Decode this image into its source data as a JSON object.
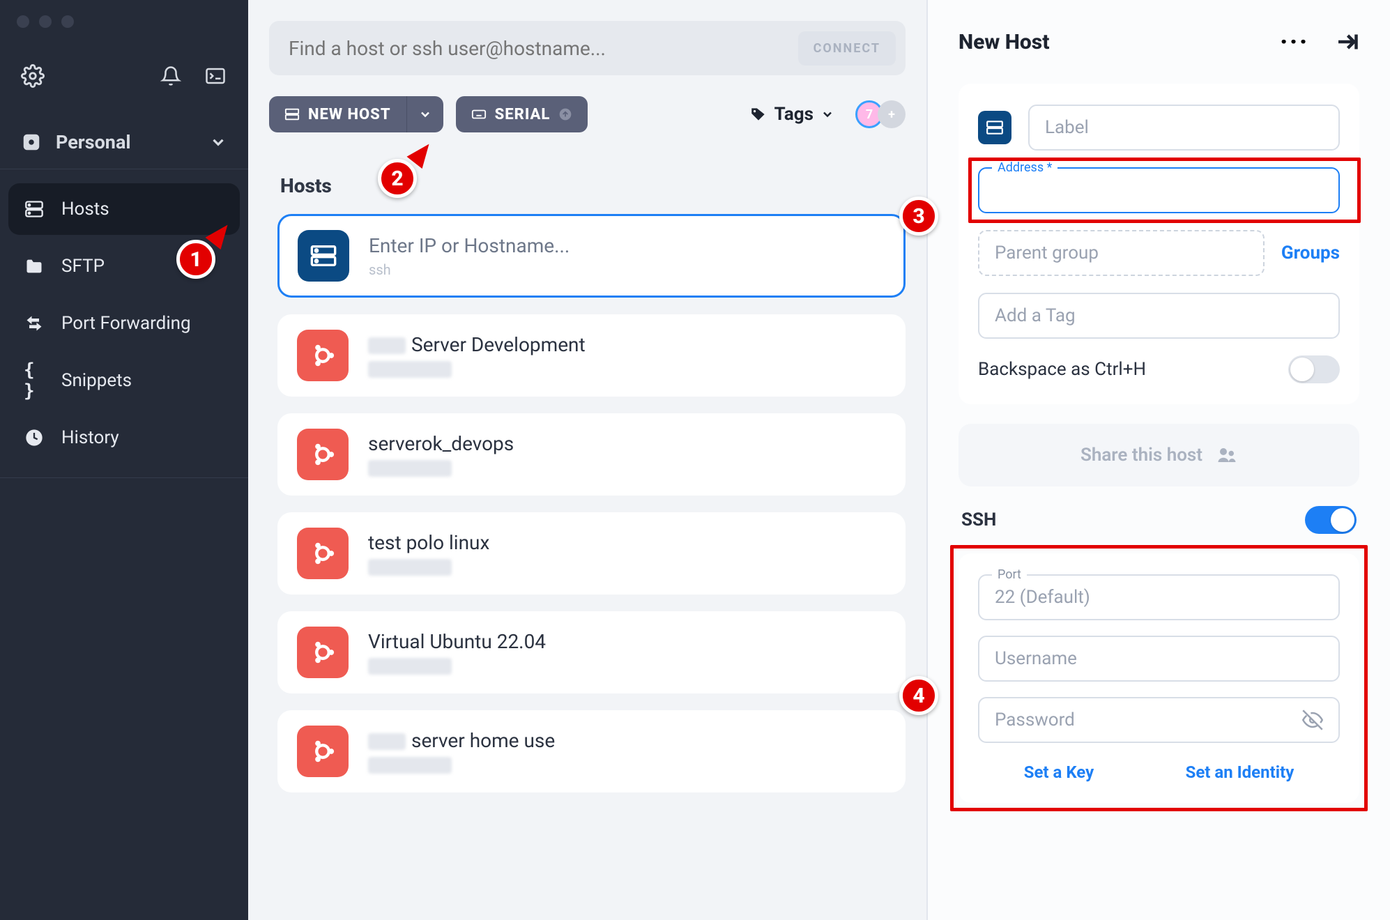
{
  "sidebar": {
    "vault_label": "Personal",
    "items": [
      {
        "label": "Hosts",
        "icon": "server",
        "active": true
      },
      {
        "label": "SFTP",
        "icon": "folder",
        "active": false
      },
      {
        "label": "Port Forwarding",
        "icon": "arrows",
        "active": false
      },
      {
        "label": "Snippets",
        "icon": "braces",
        "active": false
      },
      {
        "label": "History",
        "icon": "clock",
        "active": false
      }
    ]
  },
  "search": {
    "placeholder": "Find a host or ssh user@hostname...",
    "connect_label": "CONNECT"
  },
  "toolbar": {
    "new_host_label": "NEW HOST",
    "serial_label": "SERIAL",
    "tags_label": "Tags",
    "avatar_badge": "7"
  },
  "hosts": {
    "section_title": "Hosts",
    "new_entry": {
      "title": "Enter IP or Hostname...",
      "sub": "ssh"
    },
    "list": [
      {
        "title": "Server Development",
        "has_blur_prefix": true
      },
      {
        "title": "serverok_devops",
        "has_blur_prefix": false
      },
      {
        "title": "test polo linux",
        "has_blur_prefix": false
      },
      {
        "title": "Virtual Ubuntu 22.04",
        "has_blur_prefix": false
      },
      {
        "title": "server home use",
        "has_blur_prefix": true
      }
    ]
  },
  "panel": {
    "title": "New Host",
    "label_placeholder": "Label",
    "address_label": "Address *",
    "parent_group_placeholder": "Parent group",
    "groups_link": "Groups",
    "tag_placeholder": "Add a Tag",
    "backspace_label": "Backspace as Ctrl+H",
    "share_label": "Share this host",
    "ssh_label": "SSH",
    "port_label": "Port",
    "port_placeholder": "22 (Default)",
    "username_placeholder": "Username",
    "password_placeholder": "Password",
    "set_key_label": "Set a Key",
    "set_identity_label": "Set an Identity"
  },
  "markers": [
    "1",
    "2",
    "3",
    "4"
  ]
}
